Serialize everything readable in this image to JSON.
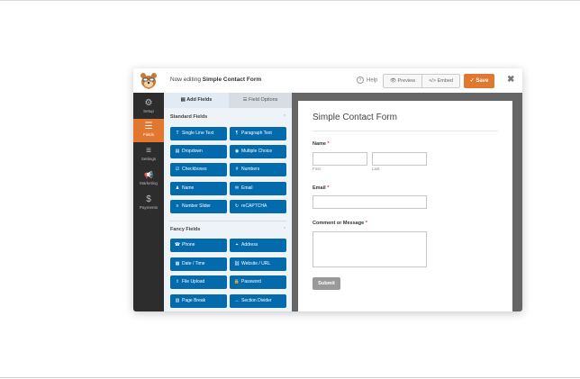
{
  "header": {
    "editing_prefix": "Now editing",
    "form_name": "Simple Contact Form",
    "help_label": "Help",
    "preview_label": "Preview",
    "embed_label": "Embed",
    "save_label": "Save",
    "close_glyph": "✖",
    "accent_color": "#e27730"
  },
  "sidebar": {
    "items": [
      {
        "label": "Setup",
        "icon": "gear-icon",
        "glyph": "⚙"
      },
      {
        "label": "Fields",
        "icon": "fields-icon",
        "glyph": "☰"
      },
      {
        "label": "Settings",
        "icon": "sliders-icon",
        "glyph": "≡"
      },
      {
        "label": "Marketing",
        "icon": "megaphone-icon",
        "glyph": "📢"
      },
      {
        "label": "Payments",
        "icon": "dollar-icon",
        "glyph": "$"
      }
    ]
  },
  "panel": {
    "tab_add_fields": "Add Fields",
    "tab_field_options": "Field Options",
    "standard_title": "Standard Fields",
    "fancy_title": "Fancy Fields",
    "standard_fields": [
      {
        "label": "Single Line Text",
        "glyph": "T"
      },
      {
        "label": "Paragraph Text",
        "glyph": "¶"
      },
      {
        "label": "Dropdown",
        "glyph": "▤"
      },
      {
        "label": "Multiple Choice",
        "glyph": "◉"
      },
      {
        "label": "Checkboxes",
        "glyph": "☑"
      },
      {
        "label": "Numbers",
        "glyph": "#"
      },
      {
        "label": "Name",
        "glyph": "♟"
      },
      {
        "label": "Email",
        "glyph": "✉"
      },
      {
        "label": "Number Slider",
        "glyph": "≡"
      },
      {
        "label": "reCAPTCHA",
        "glyph": "↻"
      }
    ],
    "fancy_fields": [
      {
        "label": "Phone",
        "glyph": "☎"
      },
      {
        "label": "Address",
        "glyph": "⌖"
      },
      {
        "label": "Date / Time",
        "glyph": "▦"
      },
      {
        "label": "Website / URL",
        "glyph": "⛓"
      },
      {
        "label": "File Upload",
        "glyph": "⇪"
      },
      {
        "label": "Password",
        "glyph": "🔒"
      },
      {
        "label": "Page Break",
        "glyph": "▥"
      },
      {
        "label": "Section Divider",
        "glyph": "↔"
      }
    ],
    "button_color": "#036aab"
  },
  "form": {
    "title": "Simple Contact Form",
    "name_label": "Name",
    "first_sublabel": "First",
    "last_sublabel": "Last",
    "email_label": "Email",
    "comment_label": "Comment or Message",
    "required_mark": "*",
    "submit_label": "Submit"
  }
}
